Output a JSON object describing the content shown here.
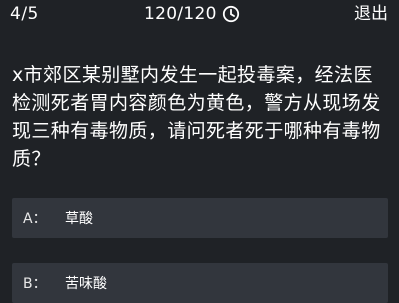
{
  "header": {
    "progress": "4/5",
    "timer": "120/120",
    "timer_icon": "clock-icon",
    "exit_label": "退出"
  },
  "question": {
    "text": "x市郊区某别墅内发生一起投毒案，经法医检测死者胃内容颜色为黄色，警方从现场发现三种有毒物质，请问死者死于哪种有毒物质？"
  },
  "options": [
    {
      "letter": "A：",
      "text": "草酸"
    },
    {
      "letter": "B：",
      "text": "苦味酸"
    }
  ],
  "colors": {
    "background": "#1f2226",
    "option_background": "#32363d",
    "text": "#ffffff"
  }
}
